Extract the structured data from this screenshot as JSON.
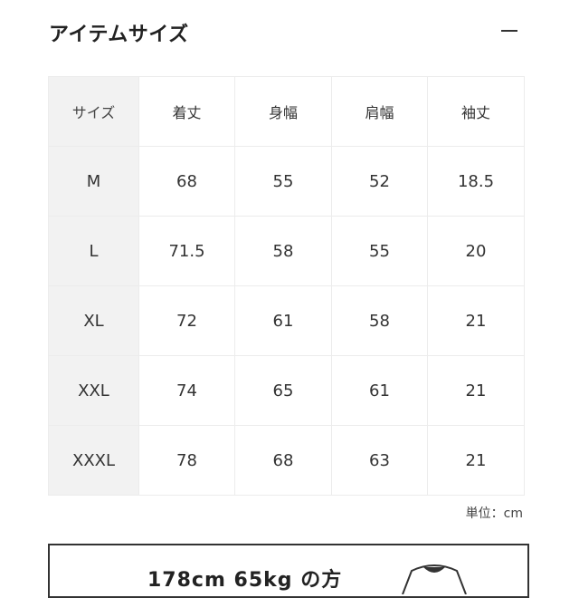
{
  "section": {
    "title": "アイテムサイズ",
    "collapse_icon": "minus-icon"
  },
  "size_table": {
    "corner_label": "サイズ",
    "columns": [
      "着丈",
      "身幅",
      "肩幅",
      "袖丈"
    ],
    "rows": [
      {
        "size": "M",
        "values": [
          "68",
          "55",
          "52",
          "18.5"
        ]
      },
      {
        "size": "L",
        "values": [
          "71.5",
          "58",
          "55",
          "20"
        ]
      },
      {
        "size": "XL",
        "values": [
          "72",
          "61",
          "58",
          "21"
        ]
      },
      {
        "size": "XXL",
        "values": [
          "74",
          "65",
          "61",
          "21"
        ]
      },
      {
        "size": "XXXL",
        "values": [
          "78",
          "68",
          "63",
          "21"
        ]
      }
    ]
  },
  "unit_note": "単位：cm",
  "model_box": {
    "text": "178cm 65kg の方"
  }
}
